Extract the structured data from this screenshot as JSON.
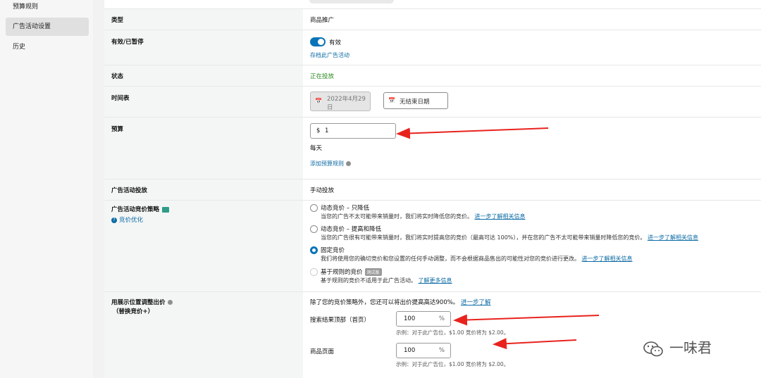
{
  "sidebar": {
    "items": [
      {
        "label": "预算规则"
      },
      {
        "label": "广告活动设置"
      },
      {
        "label": "历史"
      }
    ]
  },
  "rows": {
    "type": {
      "label": "类型",
      "value": "商品推广"
    },
    "active": {
      "label": "有效/已暂停",
      "toggle_text": "有效",
      "archive_link": "存档此广告活动"
    },
    "status": {
      "label": "状态",
      "value": "正在投放"
    },
    "schedule": {
      "label": "时间表",
      "start_line1": "2022年4月29",
      "start_line2": "日",
      "end": "无结束日期"
    },
    "budget": {
      "label": "预算",
      "currency": "$",
      "value": "1",
      "period": "每天",
      "rule_link": "添加预算规则"
    },
    "targeting": {
      "label": "广告活动投放",
      "value": "手动投放"
    },
    "bidding": {
      "label": "广告活动竞价策略",
      "help_link": "竞价优化",
      "options": [
        {
          "title": "动态竞价 – 只降低",
          "desc": "当您的广告不太可能带来销量时，我们将实时降低您的竞价。",
          "link": "进一步了解相关信息",
          "checked": false,
          "disabled": false
        },
        {
          "title": "动态竞价 – 提高和降低",
          "desc": "当您的广告很有可能带来销量时，我们将实时提高您的竞价（最高可达 100%），并在您的广告不太可能带来销量时降低您的竞价。",
          "link": "进一步了解相关信息",
          "checked": false,
          "disabled": false
        },
        {
          "title": "固定竞价",
          "desc": "我们将使用您的确切竞价和您设置的任何手动调整，而不会根据商品售出的可能性对您的竞价进行更改。",
          "link": "进一步了解相关信息",
          "checked": true,
          "disabled": false
        },
        {
          "title": "基于规则的竞价",
          "badge": "测试版",
          "desc": "基于规则的竞价不适用于此广告活动。",
          "link": "了解更多信息",
          "checked": false,
          "disabled": true
        }
      ]
    },
    "placement": {
      "label": "用展示位置调整出价",
      "sublabel": "（替换竞价+）",
      "intro": "除了您的竞价策略外，您还可以将出价提高高达900%。",
      "intro_link": "进一步了解",
      "top_label": "搜索结果顶部（首页）",
      "top_value": "100",
      "product_label": "商品页面",
      "product_value": "100",
      "percent": "%",
      "example": "示例：对于此广告位，$1.00 竞价将为 $2.00。"
    }
  },
  "watermark": {
    "text": "一味君"
  },
  "colors": {
    "accent": "#0a74b8",
    "link": "#0b6aa5",
    "status_green": "#2e8b24",
    "arrow_red": "#e8231d"
  }
}
